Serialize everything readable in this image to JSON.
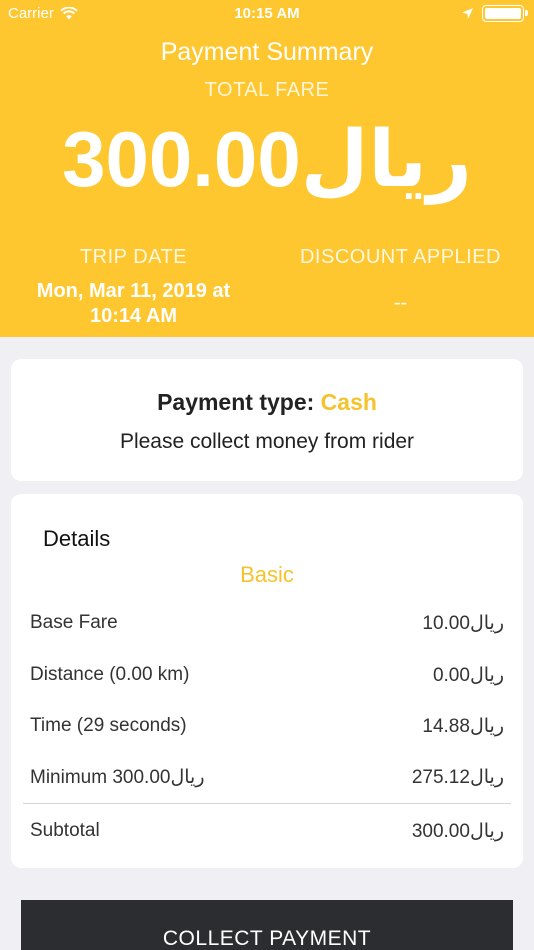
{
  "status_bar": {
    "carrier": "Carrier",
    "time": "10:15 AM"
  },
  "header": {
    "title": "Payment Summary",
    "subtitle": "TOTAL FARE",
    "total_fare": "300.00ريال",
    "trip_date_label": "TRIP DATE",
    "trip_date_line1": "Mon, Mar 11, 2019 at",
    "trip_date_line2": "10:14 AM",
    "discount_label": "DISCOUNT APPLIED",
    "discount_value": "--"
  },
  "payment": {
    "type_label": "Payment type:",
    "type_value": "Cash",
    "message": "Please collect money from rider"
  },
  "details": {
    "title": "Details",
    "section": "Basic",
    "rows": [
      {
        "name": "Base Fare",
        "amount": "10.00ريال"
      },
      {
        "name": "Distance (0.00 km)",
        "amount": "0.00ريال"
      },
      {
        "name": "Time (29 seconds)",
        "amount": "14.88ريال"
      },
      {
        "name": "Minimum 300.00ريال",
        "amount": "275.12ريال"
      }
    ],
    "subtotal_label": "Subtotal",
    "subtotal_value": "300.00ريال"
  },
  "actions": {
    "collect_label": "COLLECT PAYMENT"
  },
  "colors": {
    "brand": "#fec72f",
    "accent_text": "#f5c32c",
    "button": "#2c2d30"
  }
}
